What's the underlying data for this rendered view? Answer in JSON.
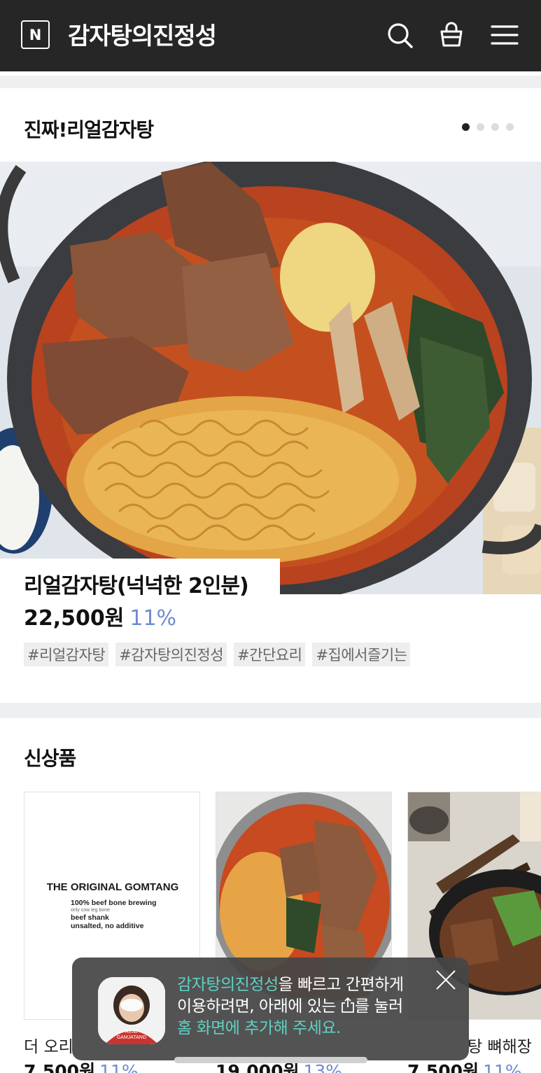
{
  "header": {
    "logo_letter": "N",
    "store_name": "감자탕의진정성",
    "icons": [
      "search-icon",
      "cart-icon",
      "menu-icon"
    ]
  },
  "featured": {
    "title": "진짜!리얼감자탕",
    "page_count": 4,
    "active_page": 1,
    "product": {
      "name": "리얼감자탕(넉넉한 2인분)",
      "price": "22,500원",
      "discount": "11%",
      "tags": [
        "#리얼감자탕",
        "#감자탕의진정성",
        "#간단요리",
        "#집에서즐기는"
      ]
    }
  },
  "new_products": {
    "title": "신상품",
    "items": [
      {
        "name": "더 오리",
        "price": "7,500원",
        "discount": "11%",
        "image_text": {
          "title": "THE ORIGINAL GOMTANG",
          "line1": "100% beef bone brewing",
          "line2": "only cow leg bone",
          "line3": "beef shank",
          "line4": "unsalted, no additive"
        }
      },
      {
        "name": "",
        "price": "19,000원",
        "discount": "13%"
      },
      {
        "name": "탕 뼈해장",
        "price": "7,500원",
        "discount": "11%"
      }
    ]
  },
  "popup": {
    "brand": "감자탕의진정성",
    "text_1": "을 빠르고 간편하게",
    "text_2": "이용하려면, 아래에 있는",
    "text_3": "를 눌러",
    "text_4": "홈 화면에 추가해 주세요.",
    "avatar_caption_1": "REAL",
    "avatar_caption_2": "GAMJATANG"
  },
  "colors": {
    "header_bg": "#262626",
    "discount": "#6d8ccf",
    "popup_accent": "#5fd1c3"
  }
}
